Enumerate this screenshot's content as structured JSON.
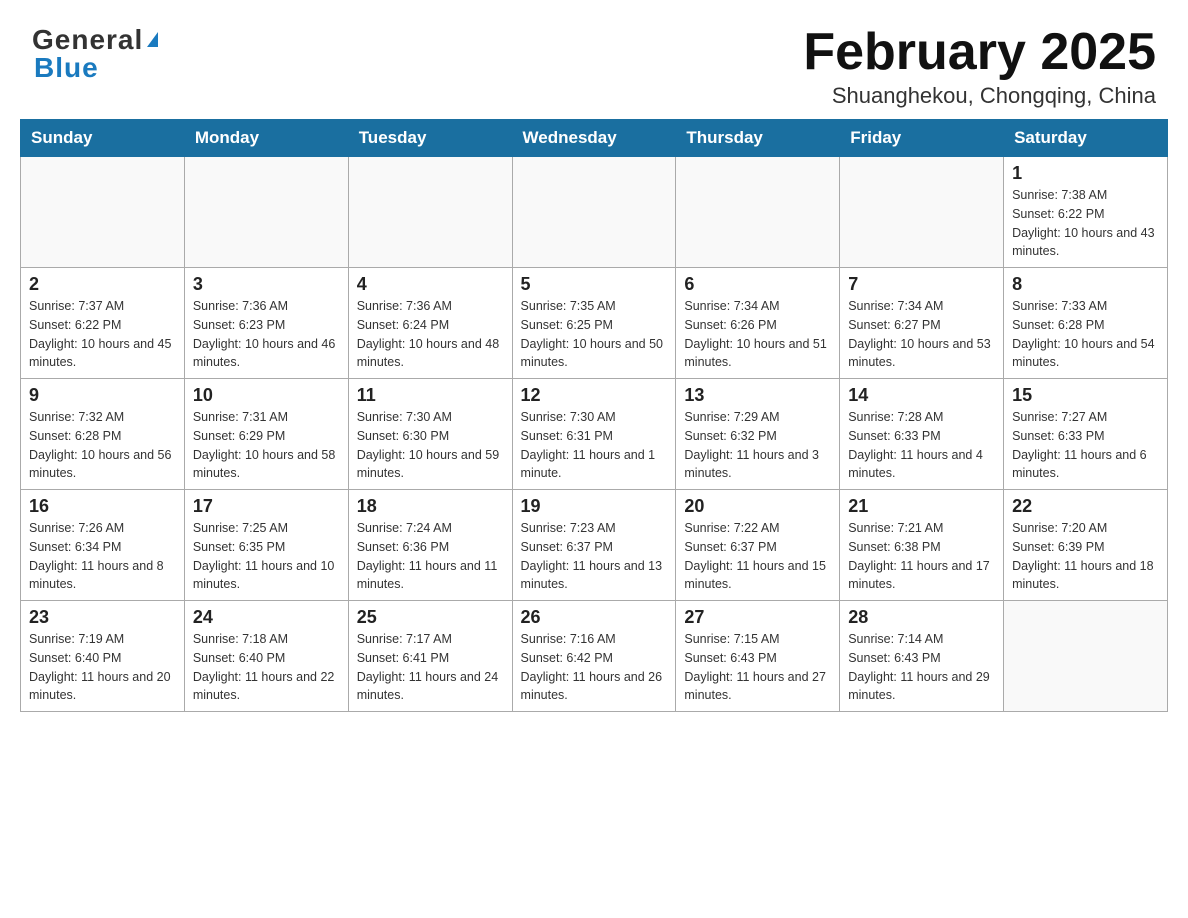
{
  "header": {
    "title": "February 2025",
    "subtitle": "Shuanghekou, Chongqing, China",
    "logo_general": "General",
    "logo_blue": "Blue"
  },
  "calendar": {
    "days_of_week": [
      "Sunday",
      "Monday",
      "Tuesday",
      "Wednesday",
      "Thursday",
      "Friday",
      "Saturday"
    ],
    "weeks": [
      [
        {
          "day": "",
          "info": ""
        },
        {
          "day": "",
          "info": ""
        },
        {
          "day": "",
          "info": ""
        },
        {
          "day": "",
          "info": ""
        },
        {
          "day": "",
          "info": ""
        },
        {
          "day": "",
          "info": ""
        },
        {
          "day": "1",
          "info": "Sunrise: 7:38 AM\nSunset: 6:22 PM\nDaylight: 10 hours and 43 minutes."
        }
      ],
      [
        {
          "day": "2",
          "info": "Sunrise: 7:37 AM\nSunset: 6:22 PM\nDaylight: 10 hours and 45 minutes."
        },
        {
          "day": "3",
          "info": "Sunrise: 7:36 AM\nSunset: 6:23 PM\nDaylight: 10 hours and 46 minutes."
        },
        {
          "day": "4",
          "info": "Sunrise: 7:36 AM\nSunset: 6:24 PM\nDaylight: 10 hours and 48 minutes."
        },
        {
          "day": "5",
          "info": "Sunrise: 7:35 AM\nSunset: 6:25 PM\nDaylight: 10 hours and 50 minutes."
        },
        {
          "day": "6",
          "info": "Sunrise: 7:34 AM\nSunset: 6:26 PM\nDaylight: 10 hours and 51 minutes."
        },
        {
          "day": "7",
          "info": "Sunrise: 7:34 AM\nSunset: 6:27 PM\nDaylight: 10 hours and 53 minutes."
        },
        {
          "day": "8",
          "info": "Sunrise: 7:33 AM\nSunset: 6:28 PM\nDaylight: 10 hours and 54 minutes."
        }
      ],
      [
        {
          "day": "9",
          "info": "Sunrise: 7:32 AM\nSunset: 6:28 PM\nDaylight: 10 hours and 56 minutes."
        },
        {
          "day": "10",
          "info": "Sunrise: 7:31 AM\nSunset: 6:29 PM\nDaylight: 10 hours and 58 minutes."
        },
        {
          "day": "11",
          "info": "Sunrise: 7:30 AM\nSunset: 6:30 PM\nDaylight: 10 hours and 59 minutes."
        },
        {
          "day": "12",
          "info": "Sunrise: 7:30 AM\nSunset: 6:31 PM\nDaylight: 11 hours and 1 minute."
        },
        {
          "day": "13",
          "info": "Sunrise: 7:29 AM\nSunset: 6:32 PM\nDaylight: 11 hours and 3 minutes."
        },
        {
          "day": "14",
          "info": "Sunrise: 7:28 AM\nSunset: 6:33 PM\nDaylight: 11 hours and 4 minutes."
        },
        {
          "day": "15",
          "info": "Sunrise: 7:27 AM\nSunset: 6:33 PM\nDaylight: 11 hours and 6 minutes."
        }
      ],
      [
        {
          "day": "16",
          "info": "Sunrise: 7:26 AM\nSunset: 6:34 PM\nDaylight: 11 hours and 8 minutes."
        },
        {
          "day": "17",
          "info": "Sunrise: 7:25 AM\nSunset: 6:35 PM\nDaylight: 11 hours and 10 minutes."
        },
        {
          "day": "18",
          "info": "Sunrise: 7:24 AM\nSunset: 6:36 PM\nDaylight: 11 hours and 11 minutes."
        },
        {
          "day": "19",
          "info": "Sunrise: 7:23 AM\nSunset: 6:37 PM\nDaylight: 11 hours and 13 minutes."
        },
        {
          "day": "20",
          "info": "Sunrise: 7:22 AM\nSunset: 6:37 PM\nDaylight: 11 hours and 15 minutes."
        },
        {
          "day": "21",
          "info": "Sunrise: 7:21 AM\nSunset: 6:38 PM\nDaylight: 11 hours and 17 minutes."
        },
        {
          "day": "22",
          "info": "Sunrise: 7:20 AM\nSunset: 6:39 PM\nDaylight: 11 hours and 18 minutes."
        }
      ],
      [
        {
          "day": "23",
          "info": "Sunrise: 7:19 AM\nSunset: 6:40 PM\nDaylight: 11 hours and 20 minutes."
        },
        {
          "day": "24",
          "info": "Sunrise: 7:18 AM\nSunset: 6:40 PM\nDaylight: 11 hours and 22 minutes."
        },
        {
          "day": "25",
          "info": "Sunrise: 7:17 AM\nSunset: 6:41 PM\nDaylight: 11 hours and 24 minutes."
        },
        {
          "day": "26",
          "info": "Sunrise: 7:16 AM\nSunset: 6:42 PM\nDaylight: 11 hours and 26 minutes."
        },
        {
          "day": "27",
          "info": "Sunrise: 7:15 AM\nSunset: 6:43 PM\nDaylight: 11 hours and 27 minutes."
        },
        {
          "day": "28",
          "info": "Sunrise: 7:14 AM\nSunset: 6:43 PM\nDaylight: 11 hours and 29 minutes."
        },
        {
          "day": "",
          "info": ""
        }
      ]
    ]
  }
}
